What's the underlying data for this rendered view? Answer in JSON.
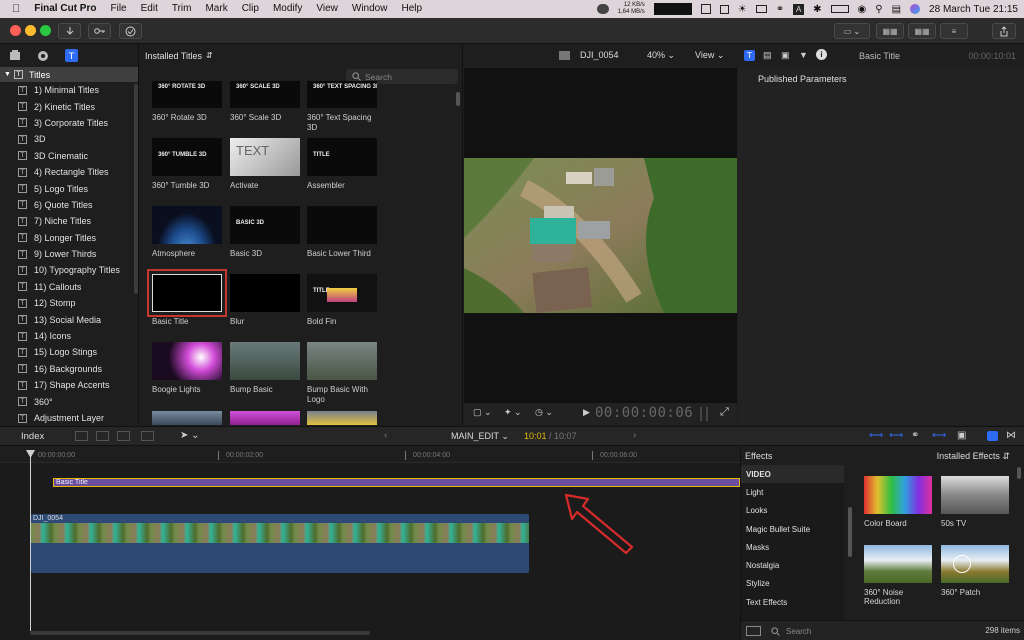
{
  "menubar": {
    "app_name": "Final Cut Pro",
    "items": [
      "File",
      "Edit",
      "Trim",
      "Mark",
      "Clip",
      "Modify",
      "View",
      "Window",
      "Help"
    ],
    "net_up": "12 KB/s",
    "net_down": "1,64 MB/s",
    "datetime": "28 March Tue  21:15"
  },
  "browser": {
    "header": "Installed Titles",
    "search_placeholder": "Search",
    "sidebar": {
      "root": "Titles",
      "items": [
        "1) Minimal Titles",
        "2) Kinetic Titles",
        "3) Corporate Titles",
        "3D",
        "3D Cinematic",
        "4) Rectangle Titles",
        "5) Logo Titles",
        "6) Quote Titles",
        "7) Niche Titles",
        "8) Longer Titles",
        "9) Lower Thirds",
        "10) Typography Titles",
        "11) Callouts",
        "12) Stomp",
        "13) Social Media",
        "14) Icons",
        "15) Logo Stings",
        "16) Backgrounds",
        "17) Shape Accents",
        "360°",
        "Adjustment Layer"
      ]
    },
    "thumbs": [
      {
        "label": "360° Rotate 3D",
        "overlay": "360° ROTATE 3D"
      },
      {
        "label": "360° Scale 3D",
        "overlay": "360° SCALE 3D"
      },
      {
        "label": "360° Text Spacing 3D",
        "overlay": "360° TEXT SPACING 3D"
      },
      {
        "label": "360° Tumble 3D",
        "overlay": "360° TUMBLE 3D"
      },
      {
        "label": "Activate",
        "overlay": "TEXT"
      },
      {
        "label": "Assembler",
        "overlay": "TITLE"
      },
      {
        "label": "Atmosphere",
        "overlay": ""
      },
      {
        "label": "Basic 3D",
        "overlay": "BASIC 3D"
      },
      {
        "label": "Basic Lower Third",
        "overlay": ""
      },
      {
        "label": "Basic Title",
        "overlay": ""
      },
      {
        "label": "Blur",
        "overlay": ""
      },
      {
        "label": "Bold Fin",
        "overlay": "TITLE"
      },
      {
        "label": "Boogie Lights",
        "overlay": ""
      },
      {
        "label": "Bump Basic",
        "overlay": ""
      },
      {
        "label": "Bump Basic With Logo",
        "overlay": ""
      }
    ]
  },
  "viewer": {
    "clip_name": "DJI_0054",
    "zoom": "40%",
    "view_label": "View",
    "timecode": "00:00:00:06"
  },
  "inspector": {
    "title": "Basic Title",
    "duration": "00:00:10:01",
    "section": "Published Parameters"
  },
  "timeline": {
    "index_label": "Index",
    "project": "MAIN_EDIT",
    "position": "10:01",
    "total": "10:07",
    "ruler": [
      "00:00:00:00",
      "00:00:02:00",
      "00:00:04:00",
      "00:00:06:00"
    ],
    "title_clip": "Basic Title",
    "video_clip": "DJI_0054"
  },
  "effects": {
    "header": "Effects",
    "installed": "Installed Effects",
    "categories": [
      "VIDEO",
      "Light",
      "Looks",
      "Magic Bullet Suite",
      "Masks",
      "Nostalgia",
      "Stylize",
      "Text Effects"
    ],
    "items": [
      "Color Board",
      "50s TV",
      "360° Noise Reduction",
      "360° Patch"
    ],
    "search_placeholder": "Search",
    "count": "298 items"
  },
  "colors": {
    "accent_blue": "#2f6bf2",
    "selection_red": "#c0392b",
    "title_purple": "#6b4ea0",
    "clip_blue": "#2c4a73",
    "timecode_yellow": "#e6b800"
  }
}
